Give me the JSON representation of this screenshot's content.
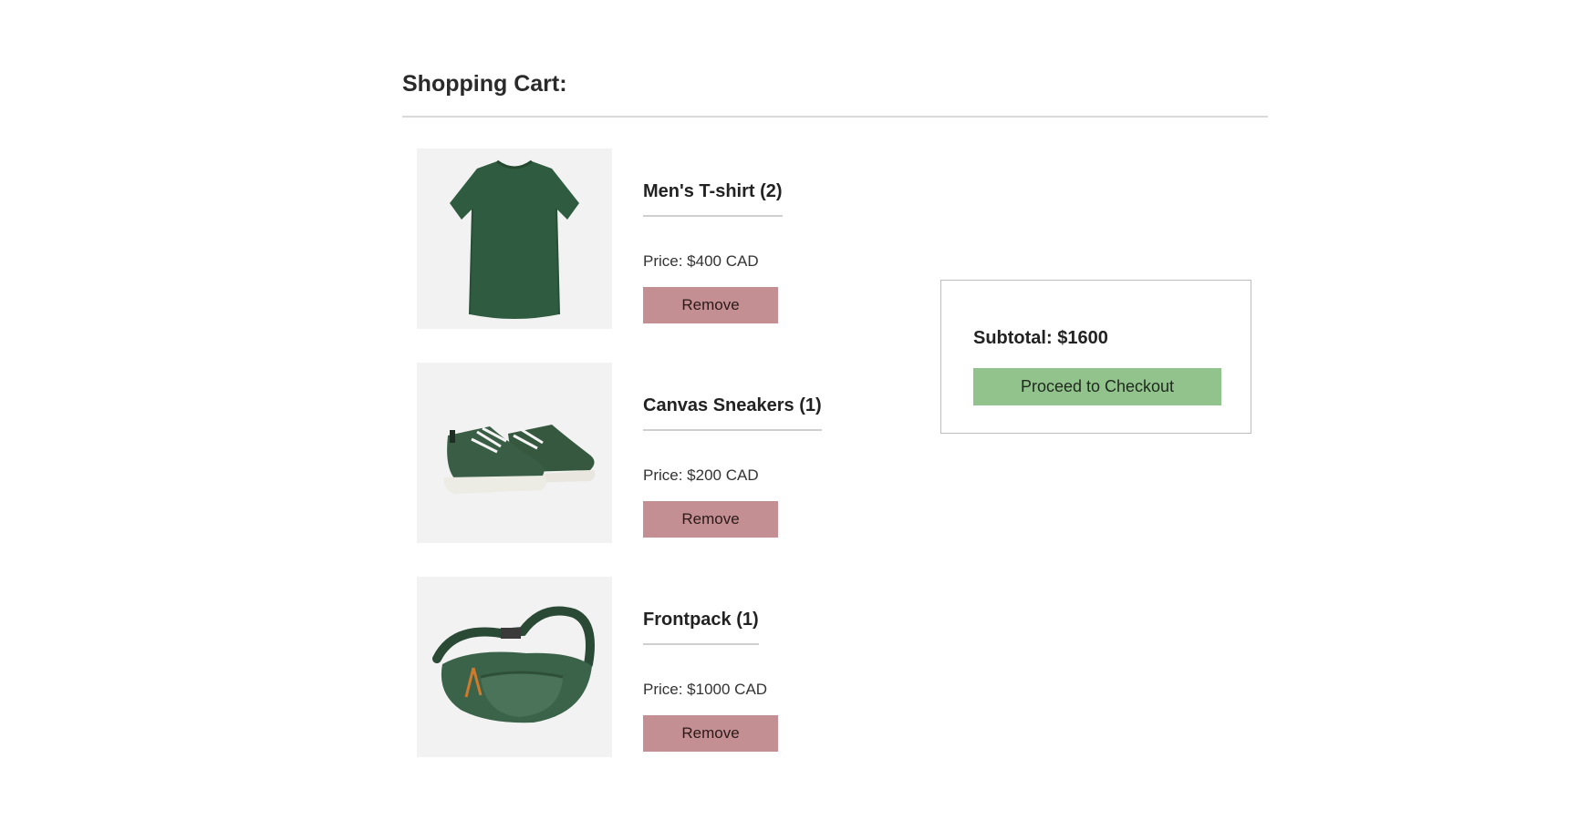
{
  "cart": {
    "title": "Shopping Cart:"
  },
  "items": [
    {
      "name": "Men's T-shirt (2)",
      "price": "Price: $400 CAD",
      "remove_label": "Remove",
      "image_icon": "t-shirt-image",
      "image_color": "#2f5c40"
    },
    {
      "name": "Canvas Sneakers (1)",
      "price": "Price: $200 CAD",
      "remove_label": "Remove",
      "image_icon": "sneakers-image",
      "image_color": "#3a5d45"
    },
    {
      "name": "Frontpack (1)",
      "price": "Price: $1000 CAD",
      "remove_label": "Remove",
      "image_icon": "frontpack-image",
      "image_color": "#3b6349"
    }
  ],
  "summary": {
    "subtotal": "Subtotal: $1600",
    "checkout_label": "Proceed to Checkout"
  },
  "colors": {
    "remove_button": "#c48f92",
    "checkout_button": "#92c38d",
    "thumbnail_background": "#f2f2f2"
  }
}
